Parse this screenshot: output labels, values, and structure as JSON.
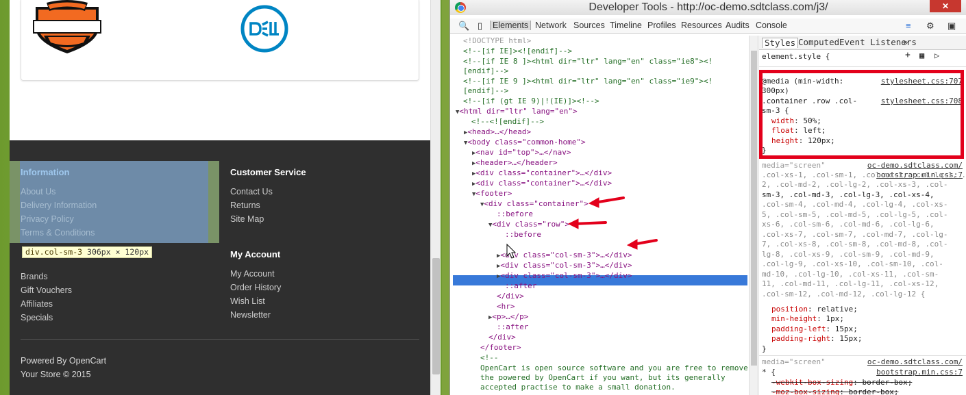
{
  "page": {
    "brands": {
      "hd_alt": "Harley-Davidson Motor Company",
      "dell_alt": "DELL"
    },
    "footer": {
      "information": {
        "title": "Information",
        "links": [
          "About Us",
          "Delivery Information",
          "Privacy Policy",
          "Terms & Conditions"
        ]
      },
      "customer_service": {
        "title": "Customer Service",
        "links": [
          "Contact Us",
          "Returns",
          "Site Map"
        ]
      },
      "extras": {
        "links": [
          "Brands",
          "Gift Vouchers",
          "Affiliates",
          "Specials"
        ]
      },
      "my_account": {
        "title": "My Account",
        "links": [
          "My Account",
          "Order History",
          "Wish List",
          "Newsletter"
        ]
      },
      "powered_by": "Powered By",
      "powered_link": "OpenCart",
      "copyright": "Your Store © 2015"
    },
    "inspect_tooltip": {
      "selector": "div.col-sm-3",
      "size": "306px × 120px"
    }
  },
  "devtools": {
    "title": "Developer Tools - http://oc-demo.sdtclass.com/j3/",
    "tabs": [
      "Elements",
      "Network",
      "Sources",
      "Timeline",
      "Profiles",
      "Resources",
      "Audits",
      "Console"
    ],
    "active_tab": "Elements",
    "style_tabs": [
      "Styles",
      "Computed",
      "Event Listeners"
    ],
    "style_tabs_more": "»",
    "dom_lines": [
      "<!DOCTYPE html>",
      "<!--[if IE]><![endif]-->",
      "<!--[if IE 8 ]><html dir=\"ltr\" lang=\"en\" class=\"ie8\"><!",
      "[endif]-->",
      "<!--[if IE 9 ]><html dir=\"ltr\" lang=\"en\" class=\"ie9\"><!",
      "[endif]-->",
      "<!--[if (gt IE 9)|!(IE)]><!-->",
      "<html dir=\"ltr\" lang=\"en\">",
      "<!--<![endif]-->",
      "<head>…</head>",
      "<body class=\"common-home\">",
      "<nav id=\"top\">…</nav>",
      "<header>…</header>",
      "<div class=\"container\">…</div>",
      "<div class=\"container\">…</div>",
      "<footer>",
      "<div class=\"container\">",
      "::before",
      "<div class=\"row\">",
      "::before",
      "<div class=\"col-sm-3\">…</div>",
      "<div class=\"col-sm-3\">…</div>",
      "<div class=\"col-sm-3\">…</div>",
      "<div class=\"col-sm-3\">…</div>",
      "::after",
      "</div>",
      "<hr>",
      "<p>…</p>",
      "::after",
      "</div>",
      "</footer>",
      "<!--",
      "OpenCart is open source software and you are free to remove",
      "the powered by OpenCart if you want, but its generally",
      "accepted practise to make a small donation."
    ],
    "styles": {
      "element_style": "element.style {",
      "media_rule": {
        "query": "@media (min-width:",
        "query2": "300px)",
        "selector": ".container .row .col-",
        "selector2": "sm-3 {",
        "src1": "stylesheet.css:707",
        "src2": "stylesheet.css:708",
        "props": [
          [
            "width",
            "50%;"
          ],
          [
            "float",
            "left;"
          ],
          [
            "height",
            "120px;"
          ]
        ]
      },
      "bootstrap_rule": {
        "media": "media=\"screen\"",
        "src": "oc-demo.sdtclass.com/",
        "src2": "bootstrap.min.css:7",
        "selector_lines": [
          ".col-xs-1, .col-sm-1, .col-md-1, .col-lg-1, .col-xs-2, .col-sm-",
          "2, .col-md-2, .col-lg-2, .col-xs-3, .col-",
          "sm-3, .col-md-3, .col-lg-3, .col-xs-4,",
          ".col-sm-4, .col-md-4, .col-lg-4, .col-xs-",
          "5, .col-sm-5, .col-md-5, .col-lg-5, .col-",
          "xs-6, .col-sm-6, .col-md-6, .col-lg-6,",
          ".col-xs-7, .col-sm-7, .col-md-7, .col-lg-",
          "7, .col-xs-8, .col-sm-8, .col-md-8, .col-",
          "lg-8, .col-xs-9, .col-sm-9, .col-md-9,",
          ".col-lg-9, .col-xs-10, .col-sm-10, .col-",
          "md-10, .col-lg-10, .col-xs-11, .col-sm-",
          "11, .col-md-11, .col-lg-11, .col-xs-12,",
          ".col-sm-12, .col-md-12, .col-lg-12 {"
        ],
        "props": [
          [
            "position",
            "relative;"
          ],
          [
            "min-height",
            "1px;"
          ],
          [
            "padding-left",
            "15px;"
          ],
          [
            "padding-right",
            "15px;"
          ]
        ]
      },
      "star_rule": {
        "media": "media=\"screen\"",
        "src": "oc-demo.sdtclass.com/",
        "src2": "bootstrap.min.css:7",
        "selector": "* {",
        "props": [
          [
            "-webkit-box-sizing",
            "border-box;"
          ],
          [
            "-moz-box-sizing",
            "border-box;"
          ]
        ]
      }
    }
  },
  "colors": {
    "selection": "#3879d9",
    "highlight_box": "#e3001b",
    "footer_bg": "#2f2f2f"
  }
}
